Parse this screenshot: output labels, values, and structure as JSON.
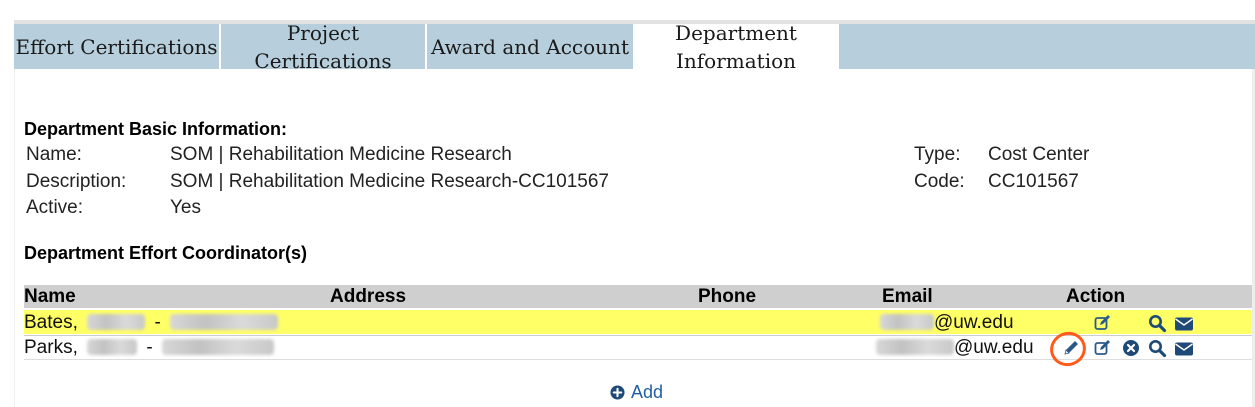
{
  "tabs": [
    {
      "label": "Effort Certifications"
    },
    {
      "label": "Project Certifications"
    },
    {
      "label": "Award and Account"
    },
    {
      "label": "Department Information"
    }
  ],
  "basic": {
    "heading": "Department Basic Information:",
    "name_label": "Name:",
    "name_value": "SOM | Rehabilitation Medicine Research",
    "description_label": "Description:",
    "description_value": "SOM | Rehabilitation Medicine Research-CC101567",
    "active_label": "Active:",
    "active_value": "Yes",
    "type_label": "Type:",
    "type_value": "Cost Center",
    "code_label": "Code:",
    "code_value": "CC101567"
  },
  "coordinators": {
    "heading": "Department Effort Coordinator(s)",
    "columns": [
      "Name",
      "Address",
      "Phone",
      "Email",
      "Action"
    ],
    "rows": [
      {
        "name": "Bates,",
        "separator": "-",
        "email_domain": "@uw.edu",
        "highlight": "#ffff66"
      },
      {
        "name": "Parks,",
        "separator": "-",
        "email_domain": "@uw.edu"
      }
    ]
  },
  "add_label": "Add",
  "colors": {
    "tab_bg": "#b7cfdc",
    "highlight": "#ffff66",
    "icon": "#2b5a8a",
    "annotation": "#ff5a1a"
  }
}
